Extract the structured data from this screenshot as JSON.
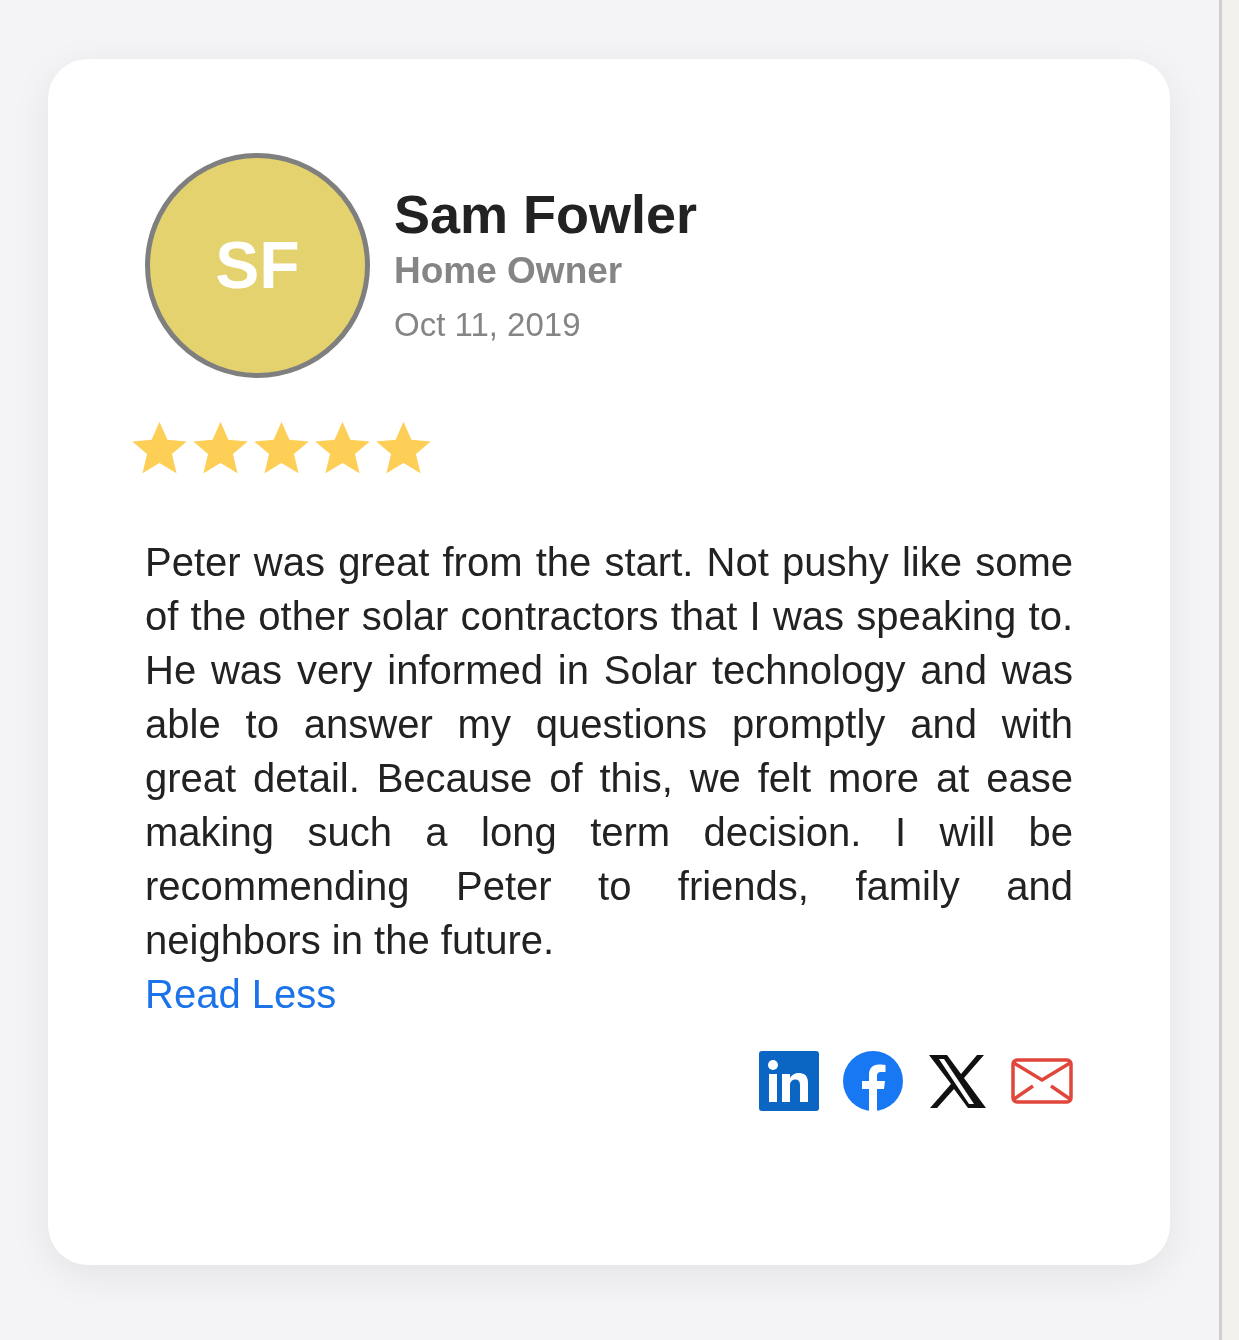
{
  "review": {
    "avatar_initials": "SF",
    "name": "Sam Fowler",
    "role": "Home Owner",
    "date": "Oct 11, 2019",
    "stars": 5,
    "text": "Peter was great from the start. Not pushy like some of the other solar contractors that I was speaking to. He was very informed in Solar technology and was able to answer my questions promptly and with great detail. Because of this, we felt more at ease making such a long term decision. I will be recommending Peter to friends, family and neighbors in the future.",
    "toggle_link": "Read Less",
    "share": [
      {
        "kind": "linkedin"
      },
      {
        "kind": "facebook"
      },
      {
        "kind": "x"
      },
      {
        "kind": "email"
      }
    ]
  }
}
